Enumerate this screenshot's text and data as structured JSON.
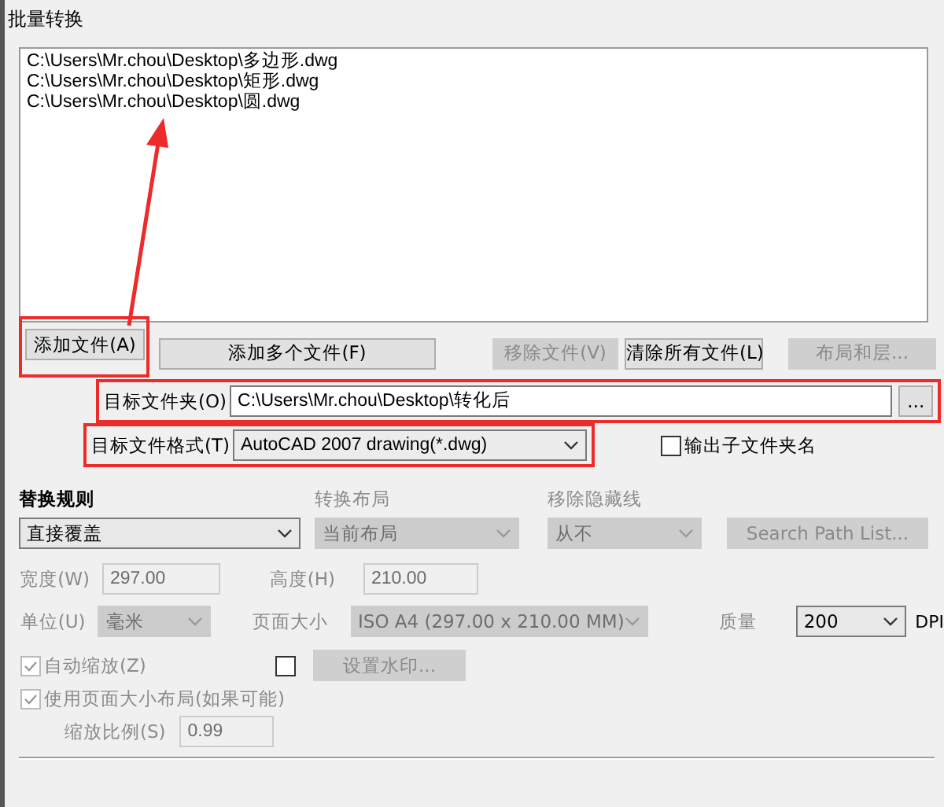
{
  "window": {
    "title": "批量转换"
  },
  "file_list": [
    "C:\\Users\\Mr.chou\\Desktop\\多边形.dwg",
    "C:\\Users\\Mr.chou\\Desktop\\矩形.dwg",
    "C:\\Users\\Mr.chou\\Desktop\\圆.dwg"
  ],
  "file_buttons": [
    {
      "label": "添加文件(A)",
      "disabled": false,
      "highlighted": true
    },
    {
      "label": "添加多个文件(F)",
      "disabled": false,
      "highlighted": false
    },
    {
      "label": "移除文件(V)",
      "disabled": true,
      "highlighted": false
    },
    {
      "label": "清除所有文件(L)",
      "disabled": false,
      "highlighted": false
    },
    {
      "label": "布局和层...",
      "disabled": true,
      "highlighted": false
    }
  ],
  "target_folder": {
    "label": "目标文件夹(O)",
    "value": "C:\\Users\\Mr.chou\\Desktop\\转化后",
    "browse": "...",
    "highlighted": true
  },
  "target_format": {
    "label": "目标文件格式(T)",
    "value": "AutoCAD 2007 drawing(*.dwg)",
    "highlighted": true
  },
  "output_subfolder": {
    "label": "输出子文件夹名",
    "checked": false
  },
  "options": [
    {
      "label": "替换规则",
      "value": "直接覆盖",
      "disabled": false
    },
    {
      "label": "转换布局",
      "value": "当前布局",
      "disabled": true
    },
    {
      "label": "移除隐藏线",
      "value": "从不",
      "disabled": true
    }
  ],
  "search_path_button": {
    "label": "Search Path List...",
    "disabled": true
  },
  "width": {
    "label": "宽度(W)",
    "value": "297.00",
    "disabled": true
  },
  "height": {
    "label": "高度(H)",
    "value": "210.00",
    "disabled": true
  },
  "unit": {
    "label": "单位(U)",
    "value": "毫米",
    "disabled": true
  },
  "page_size": {
    "label": "页面大小",
    "value": "ISO A4 (297.00 x 210.00 MM)",
    "disabled": true
  },
  "quality": {
    "label": "质量",
    "value": "200",
    "disabled": false,
    "unit": "DPI"
  },
  "auto_scale": {
    "label": "自动缩放(Z)",
    "checked": true,
    "disabled": true
  },
  "watermark": {
    "checked": false,
    "button": "设置水印...",
    "disabled": true
  },
  "use_page_size": {
    "label": "使用页面大小布局(如果可能)",
    "checked": true,
    "disabled": true
  },
  "scale_ratio": {
    "label": "缩放比例(S)",
    "value": "0.99",
    "disabled": true
  },
  "annotation_arrow": true
}
